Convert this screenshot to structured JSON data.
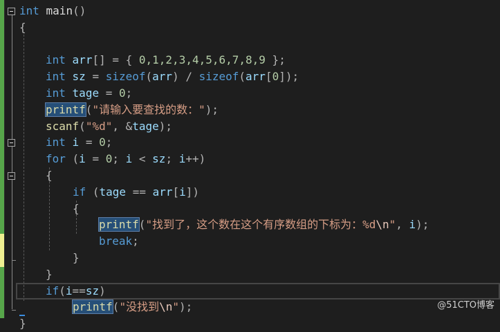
{
  "editor": {
    "lines": [
      {
        "indent": 0,
        "tokens": [
          {
            "t": "int",
            "c": "kw"
          },
          {
            "t": " main",
            "c": "plain"
          },
          {
            "t": "()",
            "c": "op"
          }
        ]
      },
      {
        "indent": 0,
        "tokens": [
          {
            "t": "{",
            "c": "op"
          }
        ]
      },
      {
        "indent": 1,
        "tokens": []
      },
      {
        "indent": 1,
        "tokens": [
          {
            "t": "int",
            "c": "kw"
          },
          {
            "t": " ",
            "c": "plain"
          },
          {
            "t": "arr",
            "c": "id"
          },
          {
            "t": "[] = { ",
            "c": "op"
          },
          {
            "t": "0,1,2,3,4,5,6,7,8,9",
            "c": "num"
          },
          {
            "t": " };",
            "c": "op"
          }
        ]
      },
      {
        "indent": 1,
        "tokens": [
          {
            "t": "int",
            "c": "kw"
          },
          {
            "t": " ",
            "c": "plain"
          },
          {
            "t": "sz",
            "c": "id"
          },
          {
            "t": " = ",
            "c": "op"
          },
          {
            "t": "sizeof",
            "c": "kw"
          },
          {
            "t": "(",
            "c": "op"
          },
          {
            "t": "arr",
            "c": "id"
          },
          {
            "t": ") / ",
            "c": "op"
          },
          {
            "t": "sizeof",
            "c": "kw"
          },
          {
            "t": "(",
            "c": "op"
          },
          {
            "t": "arr",
            "c": "id"
          },
          {
            "t": "[",
            "c": "op"
          },
          {
            "t": "0",
            "c": "num"
          },
          {
            "t": "]);",
            "c": "op"
          }
        ]
      },
      {
        "indent": 1,
        "tokens": [
          {
            "t": "int",
            "c": "kw"
          },
          {
            "t": " ",
            "c": "plain"
          },
          {
            "t": "tage",
            "c": "id"
          },
          {
            "t": " = ",
            "c": "op"
          },
          {
            "t": "0",
            "c": "num"
          },
          {
            "t": ";",
            "c": "op"
          }
        ]
      },
      {
        "indent": 1,
        "tokens": [
          {
            "t": "printf",
            "c": "fn hl"
          },
          {
            "t": "(",
            "c": "op"
          },
          {
            "t": "\"请输入要查找的数：\"",
            "c": "str"
          },
          {
            "t": ");",
            "c": "op"
          }
        ]
      },
      {
        "indent": 1,
        "tokens": [
          {
            "t": "scanf",
            "c": "fn"
          },
          {
            "t": "(",
            "c": "op"
          },
          {
            "t": "\"%d\"",
            "c": "str"
          },
          {
            "t": ", &",
            "c": "op"
          },
          {
            "t": "tage",
            "c": "id"
          },
          {
            "t": ");",
            "c": "op"
          }
        ]
      },
      {
        "indent": 1,
        "tokens": [
          {
            "t": "int",
            "c": "kw"
          },
          {
            "t": " ",
            "c": "plain"
          },
          {
            "t": "i",
            "c": "id"
          },
          {
            "t": " = ",
            "c": "op"
          },
          {
            "t": "0",
            "c": "num"
          },
          {
            "t": ";",
            "c": "op"
          }
        ]
      },
      {
        "indent": 1,
        "tokens": [
          {
            "t": "for",
            "c": "kw"
          },
          {
            "t": " (",
            "c": "op"
          },
          {
            "t": "i",
            "c": "id"
          },
          {
            "t": " = ",
            "c": "op"
          },
          {
            "t": "0",
            "c": "num"
          },
          {
            "t": "; ",
            "c": "op"
          },
          {
            "t": "i",
            "c": "id"
          },
          {
            "t": " < ",
            "c": "op"
          },
          {
            "t": "sz",
            "c": "id"
          },
          {
            "t": "; ",
            "c": "op"
          },
          {
            "t": "i",
            "c": "id"
          },
          {
            "t": "++)",
            "c": "op"
          }
        ]
      },
      {
        "indent": 1,
        "tokens": [
          {
            "t": "{",
            "c": "op"
          }
        ]
      },
      {
        "indent": 2,
        "tokens": [
          {
            "t": "if",
            "c": "kw"
          },
          {
            "t": " (",
            "c": "op"
          },
          {
            "t": "tage",
            "c": "id"
          },
          {
            "t": " == ",
            "c": "op"
          },
          {
            "t": "arr",
            "c": "id"
          },
          {
            "t": "[",
            "c": "op"
          },
          {
            "t": "i",
            "c": "id"
          },
          {
            "t": "])",
            "c": "op"
          }
        ]
      },
      {
        "indent": 2,
        "tokens": [
          {
            "t": "{",
            "c": "op"
          }
        ]
      },
      {
        "indent": 3,
        "tokens": [
          {
            "t": "printf",
            "c": "fn hl"
          },
          {
            "t": "(",
            "c": "op"
          },
          {
            "t": "\"找到了，这个数在这个有序数组的下标为：%d",
            "c": "str"
          },
          {
            "t": "\\n",
            "c": "esc"
          },
          {
            "t": "\"",
            "c": "str"
          },
          {
            "t": ", ",
            "c": "op"
          },
          {
            "t": "i",
            "c": "id"
          },
          {
            "t": ");",
            "c": "op"
          }
        ]
      },
      {
        "indent": 3,
        "tokens": [
          {
            "t": "break",
            "c": "kw"
          },
          {
            "t": ";",
            "c": "op"
          }
        ]
      },
      {
        "indent": 2,
        "tokens": [
          {
            "t": "}",
            "c": "op"
          }
        ]
      },
      {
        "indent": 1,
        "tokens": [
          {
            "t": "}",
            "c": "op"
          }
        ]
      },
      {
        "indent": 1,
        "tokens": [
          {
            "t": "if",
            "c": "kw"
          },
          {
            "t": "(",
            "c": "op"
          },
          {
            "t": "i",
            "c": "id"
          },
          {
            "t": "==",
            "c": "op"
          },
          {
            "t": "sz",
            "c": "id"
          },
          {
            "t": ")",
            "c": "op"
          }
        ]
      },
      {
        "indent": 2,
        "tokens": [
          {
            "t": "printf",
            "c": "fn hl"
          },
          {
            "t": "(",
            "c": "op"
          },
          {
            "t": "\"没找到",
            "c": "str"
          },
          {
            "t": "\\n",
            "c": "esc"
          },
          {
            "t": "\"",
            "c": "str"
          },
          {
            "t": ");",
            "c": "op"
          }
        ]
      },
      {
        "indent": 0,
        "tokens": [
          {
            "t": "}",
            "c": "op"
          }
        ]
      }
    ]
  },
  "colors": {
    "keyword": "#569cd6",
    "function": "#dcdcaa",
    "identifier": "#9cdcfe",
    "number": "#b5cea8",
    "string": "#d69d85",
    "background": "#1e1e1e",
    "changed_saved": "#57a64a",
    "changed_unsaved": "#efef91"
  },
  "icons": [
    "collapse-icon"
  ],
  "watermark": "@51CTO博客"
}
